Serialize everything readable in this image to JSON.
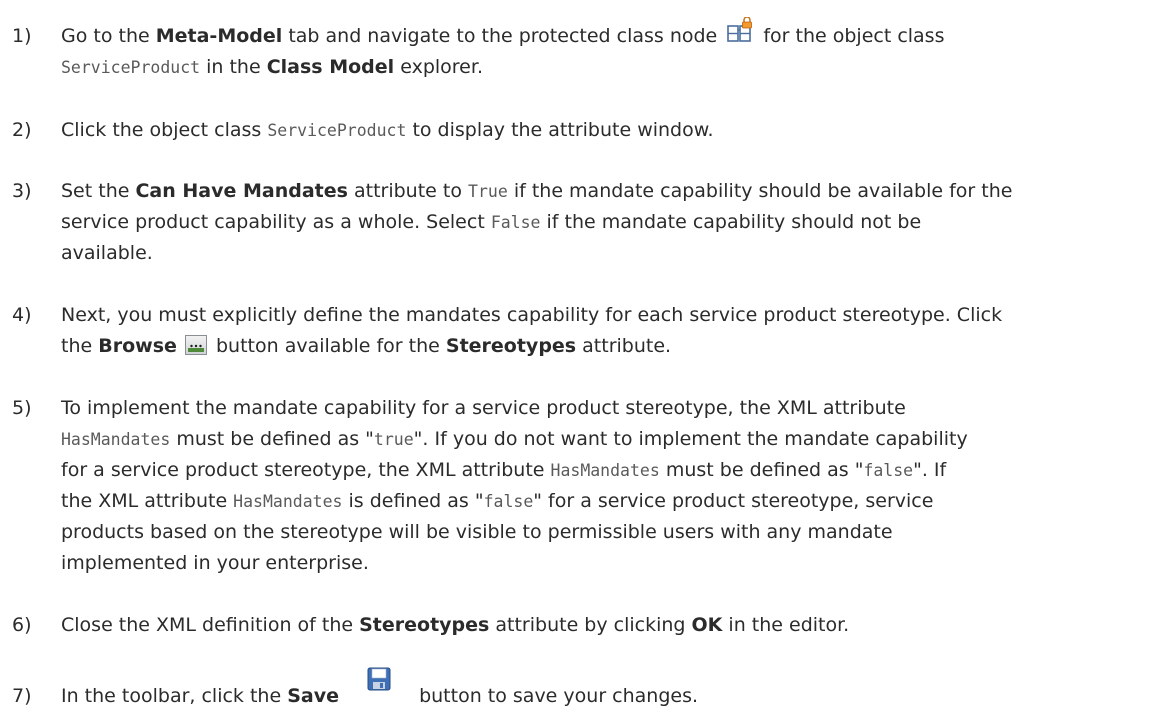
{
  "steps": [
    {
      "num": "1)",
      "parts": [
        {
          "t": "Go to the "
        },
        {
          "b": "Meta-Model"
        },
        {
          "t": " tab and navigate to the protected class node "
        },
        {
          "icon": "protected-class-node-icon"
        },
        {
          "t": " for the object class "
        },
        {
          "br": true
        },
        {
          "c": "ServiceProduct"
        },
        {
          "t": " in the "
        },
        {
          "b": "Class Model"
        },
        {
          "t": " explorer."
        }
      ]
    },
    {
      "num": "2)",
      "parts": [
        {
          "t": "Click the object class "
        },
        {
          "c": "ServiceProduct"
        },
        {
          "t": " to display the attribute window."
        }
      ]
    },
    {
      "num": "3)",
      "parts": [
        {
          "t": "Set the "
        },
        {
          "b": "Can Have Mandates"
        },
        {
          "t": " attribute to "
        },
        {
          "c": "True"
        },
        {
          "t": " if the mandate capability should be available for the "
        },
        {
          "br": true
        },
        {
          "t": "service product capability as a whole. Select "
        },
        {
          "c": "False"
        },
        {
          "t": " if the mandate capability should not be "
        },
        {
          "br": true
        },
        {
          "t": "available."
        }
      ]
    },
    {
      "num": "4)",
      "parts": [
        {
          "t": "Next, you must explicitly define the mandates capability for each service product stereotype. Click "
        },
        {
          "br": true
        },
        {
          "t": "the "
        },
        {
          "b": "Browse"
        },
        {
          "icon": "browse-icon"
        },
        {
          "t": "button available for the "
        },
        {
          "b": "Stereotypes"
        },
        {
          "t": " attribute."
        }
      ]
    },
    {
      "num": "5)",
      "parts": [
        {
          "t": "To implement the mandate capability for a service product stereotype, the XML attribute "
        },
        {
          "br": true
        },
        {
          "c": "HasMandates"
        },
        {
          "t": " must be defined as \""
        },
        {
          "c": "true"
        },
        {
          "t": "\". If you do not want to implement the mandate capability "
        },
        {
          "br": true
        },
        {
          "t": "for a service product stereotype, the XML attribute "
        },
        {
          "c": "HasMandates"
        },
        {
          "t": " must be defined as \""
        },
        {
          "c": "false"
        },
        {
          "t": "\". If "
        },
        {
          "br": true
        },
        {
          "t": "the XML attribute "
        },
        {
          "c": "HasMandates"
        },
        {
          "t": " is defined as \""
        },
        {
          "c": "false"
        },
        {
          "t": "\" for a service product stereotype, service "
        },
        {
          "br": true
        },
        {
          "t": "products based on the stereotype will be visible to permissible users with any mandate "
        },
        {
          "br": true
        },
        {
          "t": "implemented in your enterprise."
        }
      ]
    },
    {
      "num": "6)",
      "parts": [
        {
          "t": "Close the XML definition of the "
        },
        {
          "b": "Stereotypes"
        },
        {
          "t": " attribute by clicking "
        },
        {
          "b": "OK"
        },
        {
          "t": " in the editor."
        }
      ]
    },
    {
      "num": "7)",
      "parts": [
        {
          "t": "In the toolbar, click the "
        },
        {
          "b": "Save"
        },
        {
          "icon": "save-icon"
        },
        {
          "t": "button to save your changes."
        }
      ]
    }
  ]
}
